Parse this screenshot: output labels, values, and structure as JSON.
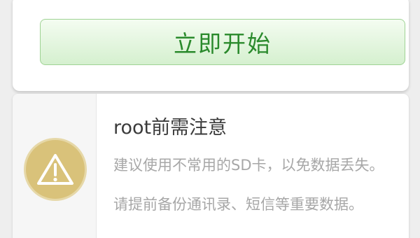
{
  "start_button": {
    "label": "立即开始"
  },
  "notice": {
    "title": "root前需注意",
    "icon": "warning-icon",
    "tips": [
      "建议使用不常用的SD卡，以免数据丢失。",
      "请提前备份通讯录、短信等重要数据。"
    ]
  },
  "colors": {
    "button_text": "#2a8a2c",
    "button_border": "#9fd394",
    "icon_background": "#d9c27a",
    "title_text": "#3b3b3b",
    "tip_text": "#a7a7a7"
  }
}
